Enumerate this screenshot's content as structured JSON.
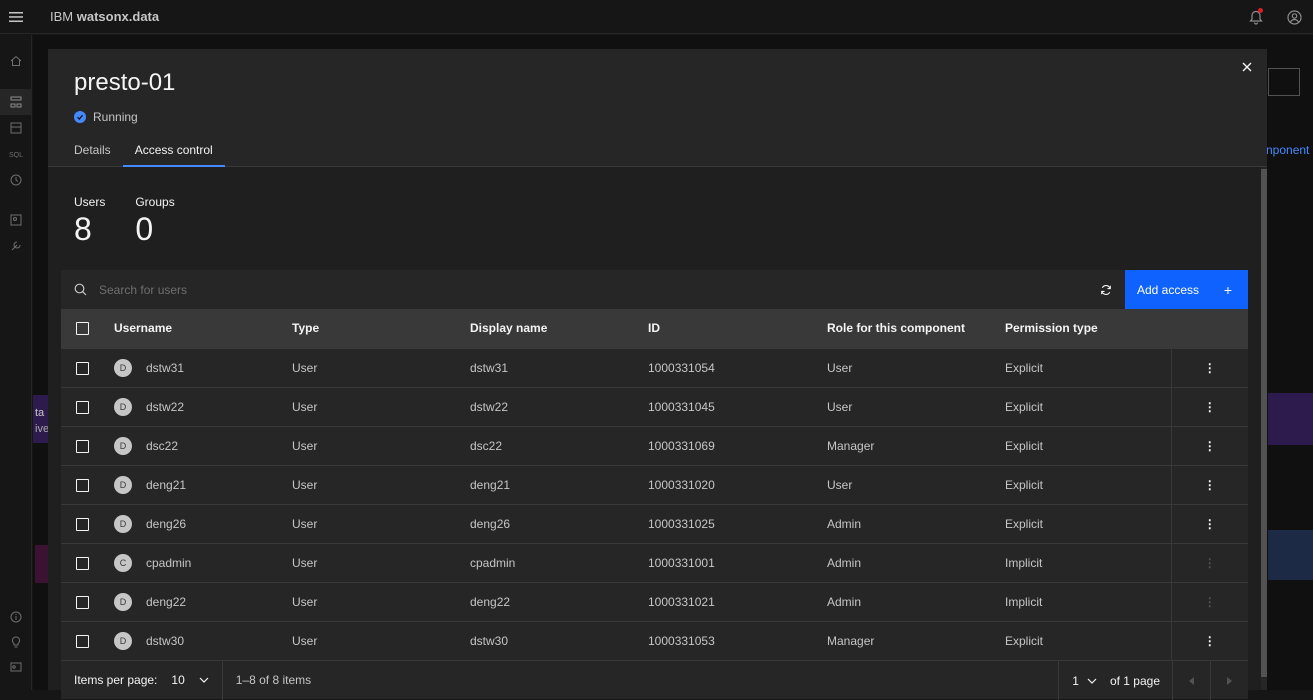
{
  "app": {
    "brand_prefix": "IBM",
    "brand_name": "watsonx.data"
  },
  "background_fragments": {
    "component_text": "nponent",
    "ta_text": "ta",
    "ive_text": "ive"
  },
  "modal": {
    "title": "presto-01",
    "status": "Running",
    "tabs": [
      {
        "label": "Details",
        "active": false
      },
      {
        "label": "Access control",
        "active": true
      }
    ],
    "counts": {
      "users_label": "Users",
      "users_value": "8",
      "groups_label": "Groups",
      "groups_value": "0"
    }
  },
  "toolbar": {
    "search_placeholder": "Search for users",
    "add_access_label": "Add access"
  },
  "table": {
    "headers": {
      "username": "Username",
      "type": "Type",
      "display_name": "Display name",
      "id": "ID",
      "role": "Role for this component",
      "permission": "Permission type"
    },
    "rows": [
      {
        "initial": "D",
        "username": "dstw31",
        "type": "User",
        "display_name": "dstw31",
        "id": "1000331054",
        "role": "User",
        "permission": "Explicit"
      },
      {
        "initial": "D",
        "username": "dstw22",
        "type": "User",
        "display_name": "dstw22",
        "id": "1000331045",
        "role": "User",
        "permission": "Explicit"
      },
      {
        "initial": "D",
        "username": "dsc22",
        "type": "User",
        "display_name": "dsc22",
        "id": "1000331069",
        "role": "Manager",
        "permission": "Explicit"
      },
      {
        "initial": "D",
        "username": "deng21",
        "type": "User",
        "display_name": "deng21",
        "id": "1000331020",
        "role": "User",
        "permission": "Explicit"
      },
      {
        "initial": "D",
        "username": "deng26",
        "type": "User",
        "display_name": "deng26",
        "id": "1000331025",
        "role": "Admin",
        "permission": "Explicit"
      },
      {
        "initial": "C",
        "username": "cpadmin",
        "type": "User",
        "display_name": "cpadmin",
        "id": "1000331001",
        "role": "Admin",
        "permission": "Implicit"
      },
      {
        "initial": "D",
        "username": "deng22",
        "type": "User",
        "display_name": "deng22",
        "id": "1000331021",
        "role": "Admin",
        "permission": "Implicit"
      },
      {
        "initial": "D",
        "username": "dstw30",
        "type": "User",
        "display_name": "dstw30",
        "id": "1000331053",
        "role": "Manager",
        "permission": "Explicit"
      }
    ]
  },
  "pagination": {
    "items_per_page_label": "Items per page:",
    "items_per_page_value": "10",
    "range_text": "1–8 of 8 items",
    "current_page": "1",
    "of_pages_text": "of 1 page"
  },
  "colors": {
    "accent": "#0f62fe",
    "status_running": "#4589ff",
    "modal_bg": "#262626"
  }
}
